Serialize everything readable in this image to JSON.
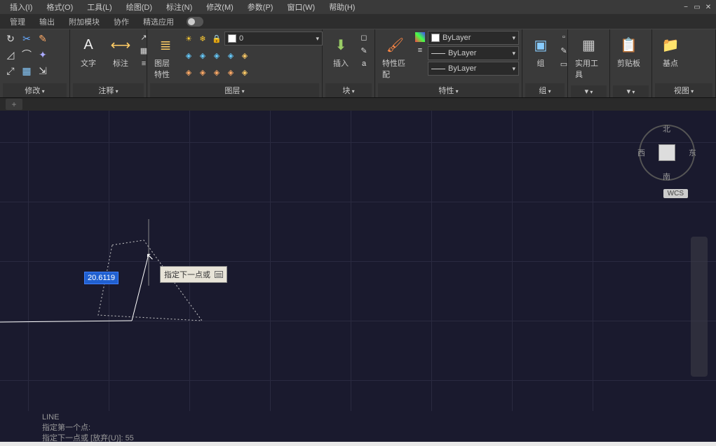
{
  "menus": {
    "insert": "插入(I)",
    "format": "格式(O)",
    "tools": "工具(L)",
    "draw": "绘图(D)",
    "dimension": "标注(N)",
    "modify": "修改(M)",
    "params": "参数(P)",
    "window": "窗口(W)",
    "help": "帮助(H)"
  },
  "subtabs": {
    "manage": "管理",
    "output": "输出",
    "addons": "附加模块",
    "collab": "协作",
    "featured": "精选应用"
  },
  "panels": {
    "modify": "修改",
    "annotate": "注释",
    "layers": "图层",
    "block": "块",
    "properties": "特性",
    "groups": "组",
    "utilities": "实用工具",
    "clipboard": "剪贴板",
    "view": "视图"
  },
  "big_buttons": {
    "text": "文字",
    "dim": "标注",
    "layer_props": "图层特性",
    "insert": "插入",
    "props_match": "特性匹配",
    "group": "组",
    "utilities": "实用工具",
    "clipboard": "剪贴板",
    "base": "基点"
  },
  "layer": {
    "current": "0"
  },
  "props": {
    "color": "ByLayer",
    "linetype": "ByLayer",
    "lineweight": "ByLayer"
  },
  "viewcube": {
    "n": "北",
    "s": "南",
    "e": "东",
    "w": "西",
    "wcs": "WCS"
  },
  "drawing": {
    "dim_value": "20.6119",
    "tooltip": "指定下一点或"
  },
  "cmd": {
    "l1": "LINE",
    "l2": "指定第一个点:",
    "l3_prefix": "指定下一点或 [放弃(U)]: ",
    "l3_val": "55"
  }
}
